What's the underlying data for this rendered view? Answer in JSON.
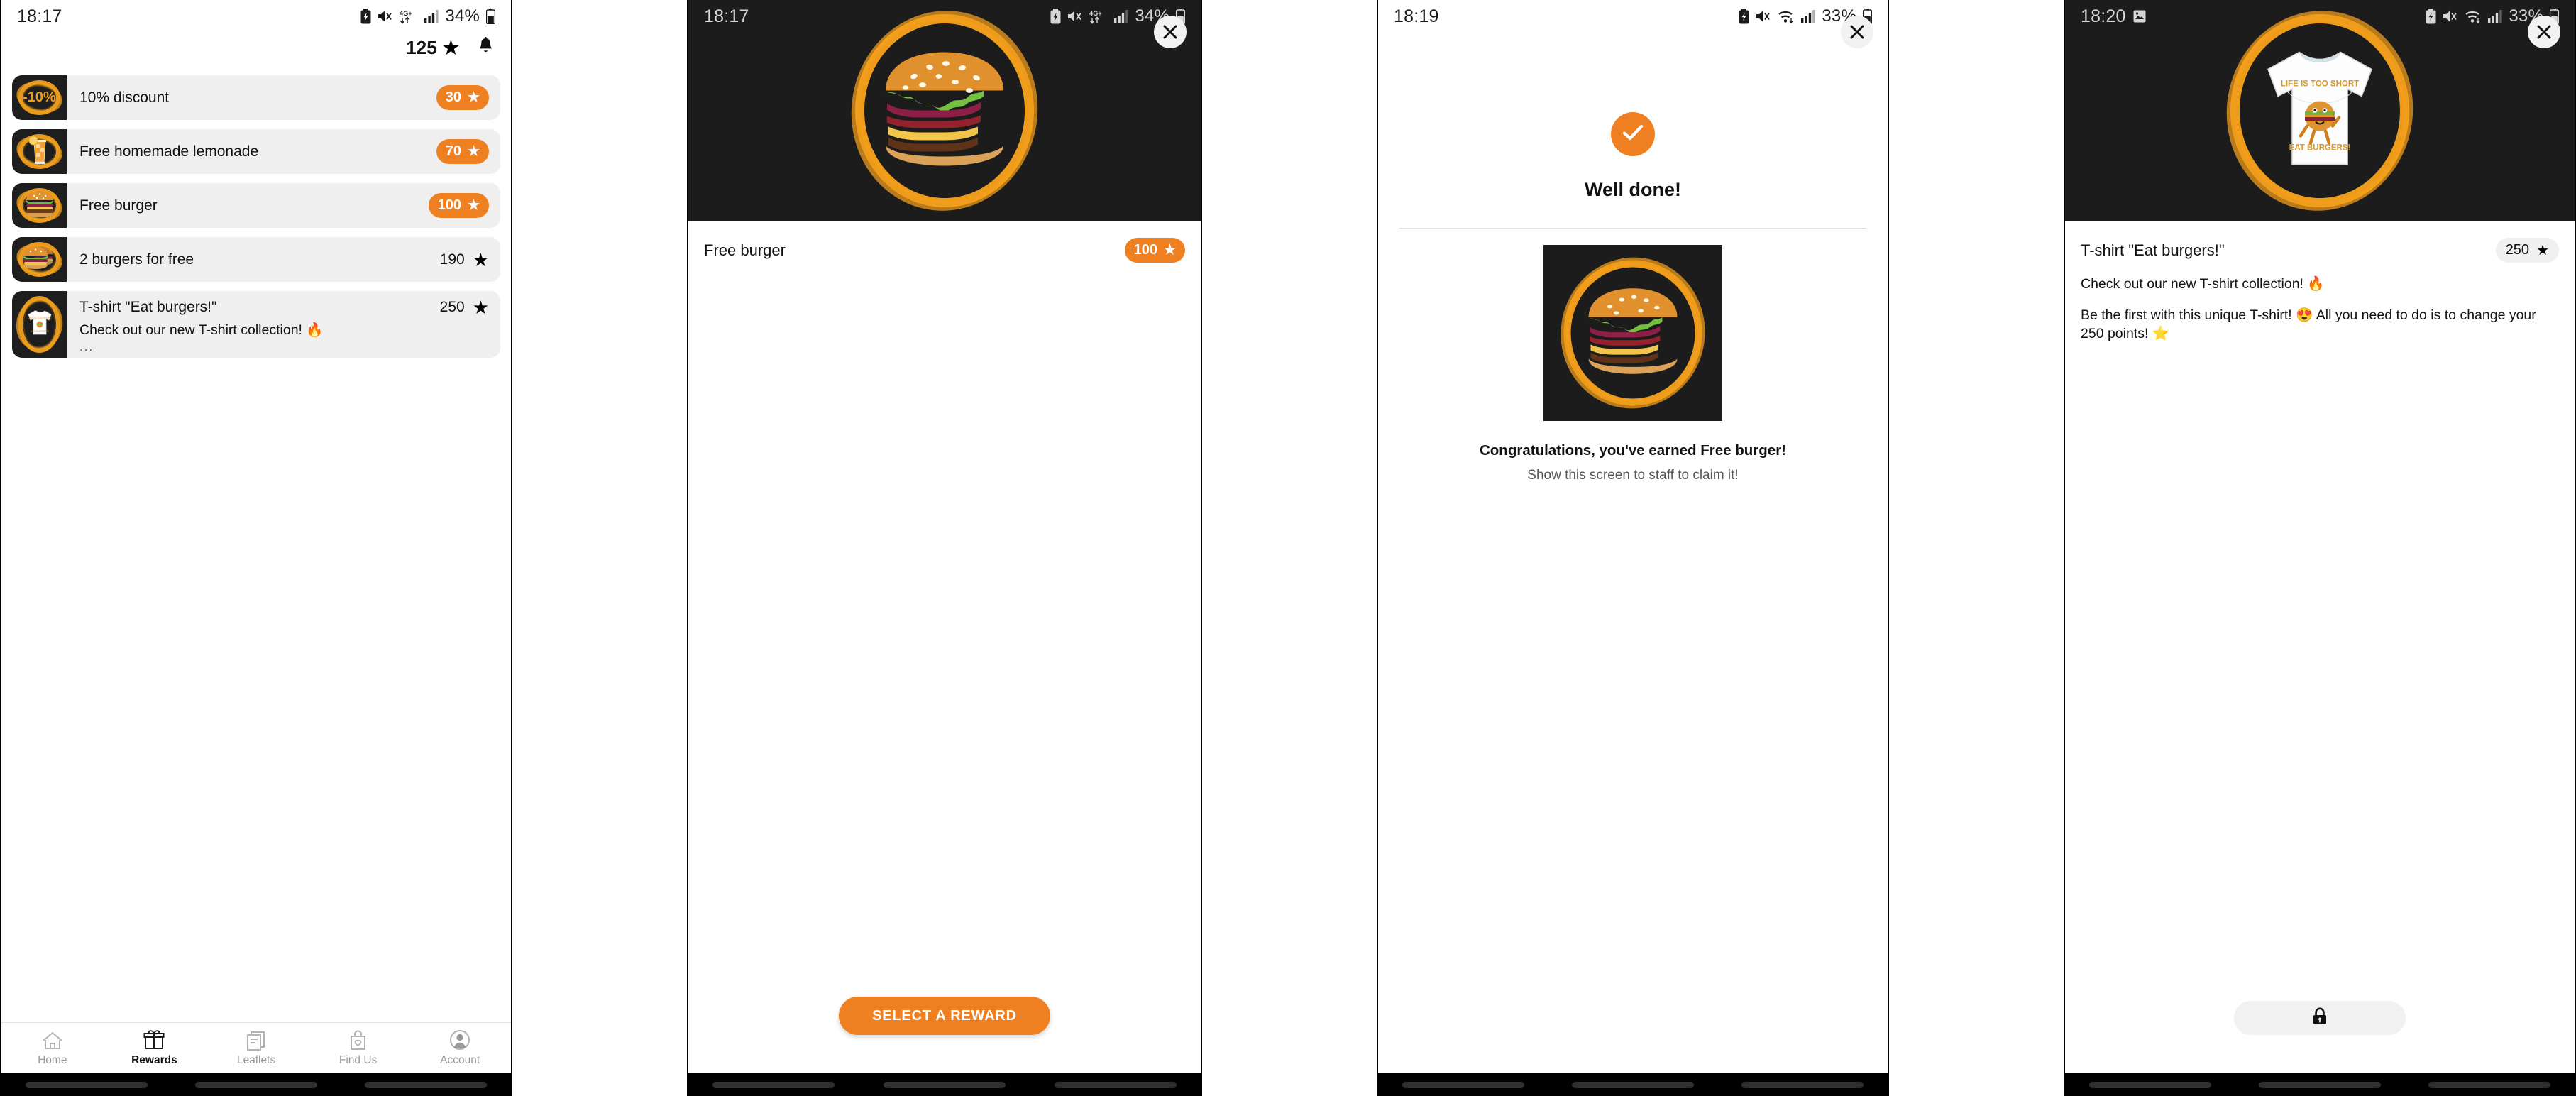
{
  "panels": {
    "rewards_list": {
      "status": {
        "time": "18:17",
        "battery_text": "34%",
        "network": "4G+",
        "icons": [
          "battery-saver-icon",
          "mute-icon",
          "network-4g-icon",
          "signal-icon",
          "battery-icon"
        ]
      },
      "header": {
        "points": "125",
        "star": "★",
        "bell": "notifications-bell-icon"
      },
      "items": [
        {
          "title": "10% discount",
          "points": "30",
          "highlight": true,
          "thumb": "-10%",
          "desc": "",
          "ellipsis": ""
        },
        {
          "title": "Free homemade lemonade",
          "points": "70",
          "highlight": true,
          "thumb": "lemonade",
          "desc": "",
          "ellipsis": ""
        },
        {
          "title": "Free burger",
          "points": "100",
          "highlight": true,
          "thumb": "burger",
          "desc": "",
          "ellipsis": ""
        },
        {
          "title": "2 burgers for free",
          "points": "190",
          "highlight": false,
          "thumb": "double-burger",
          "desc": "",
          "ellipsis": ""
        },
        {
          "title": "T-shirt \"Eat burgers!\"",
          "points": "250",
          "highlight": false,
          "thumb": "tshirt",
          "desc": "Check out our new T-shirt collection! 🔥",
          "ellipsis": "..."
        }
      ],
      "nav": [
        {
          "label": "Home",
          "icon": "home-icon",
          "active": false
        },
        {
          "label": "Rewards",
          "icon": "gift-icon",
          "active": true
        },
        {
          "label": "Leaflets",
          "icon": "leaflet-icon",
          "active": false
        },
        {
          "label": "Find Us",
          "icon": "bag-heart-icon",
          "active": false
        },
        {
          "label": "Account",
          "icon": "account-icon",
          "active": false
        }
      ]
    },
    "reward_detail": {
      "status": {
        "time": "18:17",
        "battery_text": "34%",
        "network": "4G+"
      },
      "close": "close-icon",
      "title": "Free burger",
      "points": "100",
      "star": "★",
      "cta_label": "SELECT A REWARD",
      "hero_art": "burger-hero"
    },
    "success": {
      "status": {
        "time": "18:19",
        "battery_text": "33%",
        "network": "wifi"
      },
      "close": "close-icon",
      "check": "check-icon",
      "heading": "Well done!",
      "message": "Congratulations, you've earned Free burger!",
      "submessage": "Show this screen to staff to claim it!",
      "hero_art": "burger-hero"
    },
    "locked_detail": {
      "status": {
        "time": "18:20",
        "battery_text": "33%",
        "network": "wifi",
        "extra_icon": "screenshot-icon"
      },
      "close": "close-icon",
      "title": "T-shirt \"Eat burgers!\"",
      "points": "250",
      "star": "★",
      "paragraph_1": "Check out our new T-shirt collection! 🔥",
      "paragraph_2": "Be the first with this unique T-shirt! 😍 All you need to do is to change your 250 points! ⭐",
      "lock_icon": "lock-icon",
      "hero_art": "tshirt-hero",
      "tshirt_text_top": "LIFE IS TOO SHORT",
      "tshirt_text_bottom": "EAT BURGERS!"
    }
  },
  "colors": {
    "accent": "#ef8022",
    "ring": "#f5a01c",
    "dark": "#1c1c1c",
    "card": "#efefef"
  }
}
